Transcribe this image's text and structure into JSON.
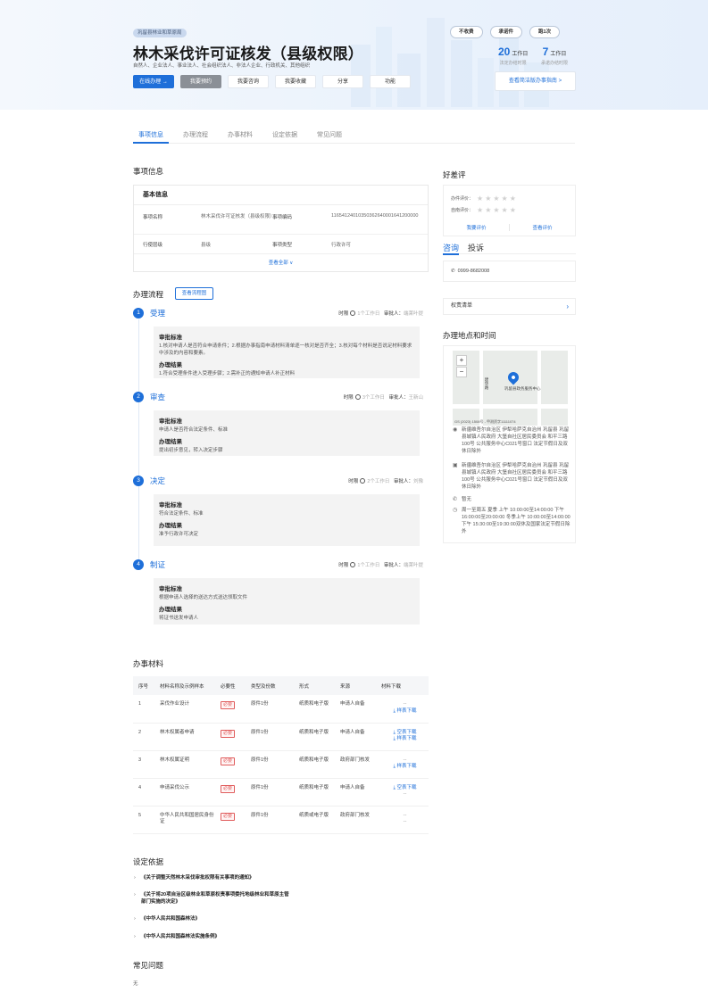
{
  "header": {
    "dept": "巩留县林业和草原局",
    "title": "林木采伐许可证核发（县级权限）",
    "subjects": "自然人、企业法人、事业法人、社会组织法人、非法人企业、行政机关、其他组织",
    "actions": [
      "在线办理 →",
      "我要预约",
      "我要咨询",
      "我要收藏",
      "分享",
      "功能"
    ],
    "pills": [
      "不收费",
      "承诺件",
      "跑1次"
    ],
    "stats": [
      {
        "num": "20",
        "unit": "工作日",
        "label": "法定办结时限"
      },
      {
        "num": "7",
        "unit": "工作日",
        "label": "承诺办结时限"
      }
    ],
    "guide": "查看简洁版办事指南 >"
  },
  "tabs": [
    "事项信息",
    "办理流程",
    "办事材料",
    "设定依据",
    "常见问题"
  ],
  "info": {
    "section": "事项信息",
    "card_title": "基本信息",
    "rows": [
      {
        "k1": "事项名称",
        "v1": "林木采伐许可证核发（县级权限）",
        "k2": "事项编码",
        "v2": "11654124010350362640001641200000"
      },
      {
        "k1": "行使层级",
        "v1": "县级",
        "k2": "事项类型",
        "v2": "行政许可"
      }
    ],
    "view_all": "查看全部 ∨"
  },
  "process": {
    "section": "办理流程",
    "flow_btn": "查看流程图",
    "time_label": "时限",
    "approver_label": "审批人：",
    "std_label": "审批标准",
    "result_label": "办理结果",
    "steps": [
      {
        "num": "1",
        "name": "受理",
        "time": "1个工作日",
        "approver": "端莱叶提",
        "std": "1.核对申请人是否符合申请条件；2.根据办事指南申请材料清单逐一核对是否齐全；3.核对每个材料是否说足材料要求中涉及的内容和要素。",
        "result": "1.符合受理条件进入受理步骤；2.需补正的通知申请人补正材料"
      },
      {
        "num": "2",
        "name": "审查",
        "time": "3个工作日",
        "approver": "王新山",
        "std": "申请人是否符合法定条件、标准",
        "result": "提出初步意见，转入决定步骤"
      },
      {
        "num": "3",
        "name": "决定",
        "time": "2个工作日",
        "approver": "刘豫",
        "std": "符合法定条件、标准",
        "result": "准予行政许可决定"
      },
      {
        "num": "4",
        "name": "制证",
        "time": "1个工作日",
        "approver": "端莱叶提",
        "std": "根据申请人选择的送达方式送达领取文件",
        "result": "将证书送发申请人"
      }
    ]
  },
  "materials": {
    "section": "办事材料",
    "headers": [
      "序号",
      "材料名称及示例样本",
      "必要性",
      "类型及份数",
      "形式",
      "来源",
      "材料下载"
    ],
    "need_label": "必要",
    "rows": [
      {
        "no": "1",
        "name": "采伐作业设计",
        "type": "原件1份",
        "form": "纸质和电子版",
        "source": "申请人自备",
        "dl": [
          "--",
          "⤓ 样表下载"
        ]
      },
      {
        "no": "2",
        "name": "林木权属者申请",
        "type": "原件1份",
        "form": "纸质和电子版",
        "source": "申请人自备",
        "dl": [
          "⤓ 空表下载",
          "⤓ 样表下载"
        ]
      },
      {
        "no": "3",
        "name": "林木权属证明",
        "type": "原件1份",
        "form": "纸质和电子版",
        "source": "政府部门核发",
        "dl": [
          "--",
          "⤓ 样表下载"
        ]
      },
      {
        "no": "4",
        "name": "申请采伐公示",
        "type": "原件1份",
        "form": "纸质和电子版",
        "source": "申请人自备",
        "dl": [
          "⤓ 空表下载",
          "--"
        ]
      },
      {
        "no": "5",
        "name": "中华人民共和国居民身份证",
        "type": "原件1份",
        "form": "纸质或电子版",
        "source": "政府部门核发",
        "dl": [
          "--",
          "--"
        ]
      }
    ]
  },
  "basis": {
    "section": "设定依据",
    "items": [
      "《关于调整天然林木采伐审批权限有关事项的通知》",
      "《关于将20项自治区级林业和草原权责事项委托地级林业和草原主管部门实施的决定》",
      "《中华人民共和国森林法》",
      "《中华人民共和国森林法实施条例》"
    ]
  },
  "faq": {
    "section": "常见问题",
    "text": "无"
  },
  "rating": {
    "section": "好差评",
    "row1": "办件评价：",
    "row2": "自南评价：",
    "stars": "★★★★★",
    "links": [
      "我要评价",
      "查看评价"
    ]
  },
  "consult": {
    "tabs": [
      "咨询",
      "投诉"
    ],
    "phone": "0999-8682008"
  },
  "rights": {
    "label": "权责清单",
    "arrow": "›"
  },
  "place": {
    "section": "办理地点和时间",
    "map_label": "巩留县政务服务中心",
    "map_road": "建华路",
    "map_copy": "GS (2023) 1508号 - 甲测资字11111074",
    "rows": [
      {
        "icon": "◉",
        "text": "新疆维吾尔自治区 伊犁哈萨克自治州 巩留县 巩留县城镇人民政府 大堡自社区居民委员会 和平三路100号 公共服务中心C021号窗口 法定节假日及双休日除外"
      },
      {
        "icon": "▣",
        "text": "新疆维吾尔自治区 伊犁哈萨克自治州 巩留县 巩留县城镇人民政府 大堡自社区居民委员会 和平三路100号 公共服务中心C021号窗口 法定节假日及双休日除外"
      },
      {
        "icon": "✆",
        "text": "暂无"
      },
      {
        "icon": "◷",
        "text": "周一至周五 夏季 上午 10:00:00至14:00:00 下午 16:00:00至20:00:00 冬季上午 10:00:00至14:00:00 下午 15:30:00至19:30:00双休及国家法定节假日除外"
      }
    ]
  },
  "colors": {
    "primary": "#1e6fd9",
    "danger": "#e05c5c"
  }
}
